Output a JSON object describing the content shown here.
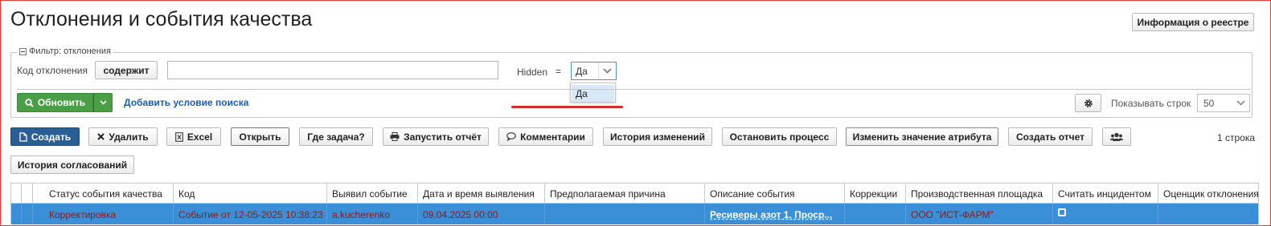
{
  "page": {
    "title": "Отклонения и события качества",
    "registry_info_button": "Информация о реестре"
  },
  "filter": {
    "legend": "Фильтр: отклонения",
    "field_label": "Код отклонения",
    "operator_button": "содержит",
    "text_value": "",
    "hidden_label": "Hidden",
    "equals_sign": "=",
    "hidden_value": "Да",
    "dropdown_options": [
      "Да"
    ],
    "refresh_button": "Обновить",
    "add_condition_link": "Добавить условие поиска",
    "rows_label": "Показывать строк",
    "rows_value": "50"
  },
  "toolbar": {
    "create": "Создать",
    "delete": "Удалить",
    "excel": "Excel",
    "open": "Открыть",
    "where_task": "Где задача?",
    "run_report": "Запустить отчёт",
    "comments": "Комментарии",
    "history": "История изменений",
    "stop_process": "Остановить процесс",
    "change_attr": "Изменить значение атрибута",
    "create_report": "Создать отчет",
    "row_count": "1 строка",
    "approval_history": "История согласований"
  },
  "table": {
    "columns": [
      "Статус события качества",
      "Код",
      "Выявил событие",
      "Дата и время выявления",
      "Предполагаемая причина",
      "Описание события",
      "Коррекции",
      "Производственная площадка",
      "Считать инцидентом",
      "Оценщик отклонения"
    ],
    "rows": [
      {
        "status": "Корректировка",
        "code": "Событие от 12-05-2025 10:38:23",
        "detected_by": "a.kucherenko",
        "detected_at": "09.04.2025 00:00",
        "cause": "",
        "description": "Ресиверы азот 1. Проср...",
        "corrections": "",
        "site": "ООО \"ИСТ-ФАРМ\"",
        "incident": false,
        "assessor": ""
      }
    ]
  },
  "colors": {
    "accent": "#2a5f96",
    "refresh_green": "#4a9e45",
    "selected_row": "#3b8fd6",
    "highlight_red": "#d32f2f"
  }
}
